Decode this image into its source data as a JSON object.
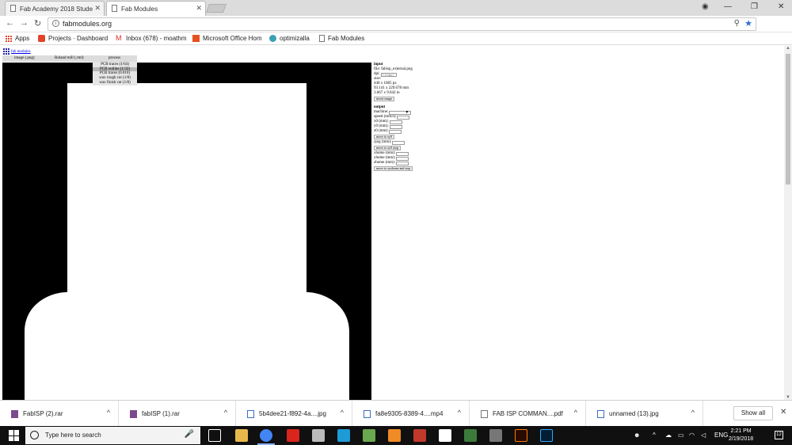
{
  "browser": {
    "tabs": [
      {
        "title": "Fab Academy 2018 Stude"
      },
      {
        "title": "Fab Modules"
      }
    ],
    "url": "fabmodules.org",
    "bookmarks": [
      {
        "label": "Apps"
      },
      {
        "label": "Projects · Dashboard"
      },
      {
        "label": "Inbox (678) - moathm"
      },
      {
        "label": "Microsoft Office Hom"
      },
      {
        "label": "optimizalla"
      },
      {
        "label": "Fab Modules"
      }
    ]
  },
  "app": {
    "link_label": "fab modules",
    "menu": {
      "input": "image (.png)",
      "output": "Roland mill (.rml)",
      "process": "process"
    },
    "process_options": [
      {
        "label": "PCB traces (1/64)",
        "selected": false
      },
      {
        "label": "PCB outline (1/32)",
        "selected": true
      },
      {
        "label": "PCB traces (0.010)",
        "selected": false
      },
      {
        "label": "wax rough cut (1/8)",
        "selected": false
      },
      {
        "label": "wax finish cut (1/8)",
        "selected": false
      }
    ],
    "input_panel": {
      "heading": "input",
      "file": "file: fabisp_external.png",
      "dpi_label": "dpi:",
      "dpi_value": "1.0 (dpi)",
      "size_label": "size:",
      "size_px": "440 x 1085 px",
      "size_mm": "93.141 x 229.678 mm",
      "size_in": "3.667 x 9.042 in",
      "invert_button": "invert image"
    },
    "output_panel": {
      "heading": "output",
      "machine_label": "machine:",
      "speed_label": "speed (mm/s):",
      "x0_label": "x0 (mm):",
      "y0_label": "y0 (mm):",
      "z0_label": "z0 (mm):",
      "move_xy0_button": "move to xy0",
      "zjog_label": "zjog (mm):",
      "move_xy0zjog_button": "move to xy0 zjog",
      "xhome_label": "xhome (mm):",
      "yhome_label": "yhome (mm):",
      "zhome_label": "zhome (mm):",
      "move_home_button": "move to xyzhome and stop"
    }
  },
  "downloads": {
    "items": [
      {
        "name": "FabISP (2).rar"
      },
      {
        "name": "fabISP (1).rar"
      },
      {
        "name": "5b4dee21-f892-4a....jpg"
      },
      {
        "name": "fa8e9305-8389-4....mp4"
      },
      {
        "name": "FAB ISP COMMAN....pdf"
      },
      {
        "name": "unnamed (13).jpg"
      }
    ],
    "show_all": "Show all"
  },
  "taskbar": {
    "search_placeholder": "Type here to search",
    "language": "ENG",
    "time": "2:21 PM",
    "date": "2/19/2018",
    "notification_count": "12"
  },
  "colors": {
    "canvas_background": "#000000",
    "board_shape": "#ffffff",
    "taskbar": "#101010",
    "chrome_accent": "#2c6fd6"
  }
}
